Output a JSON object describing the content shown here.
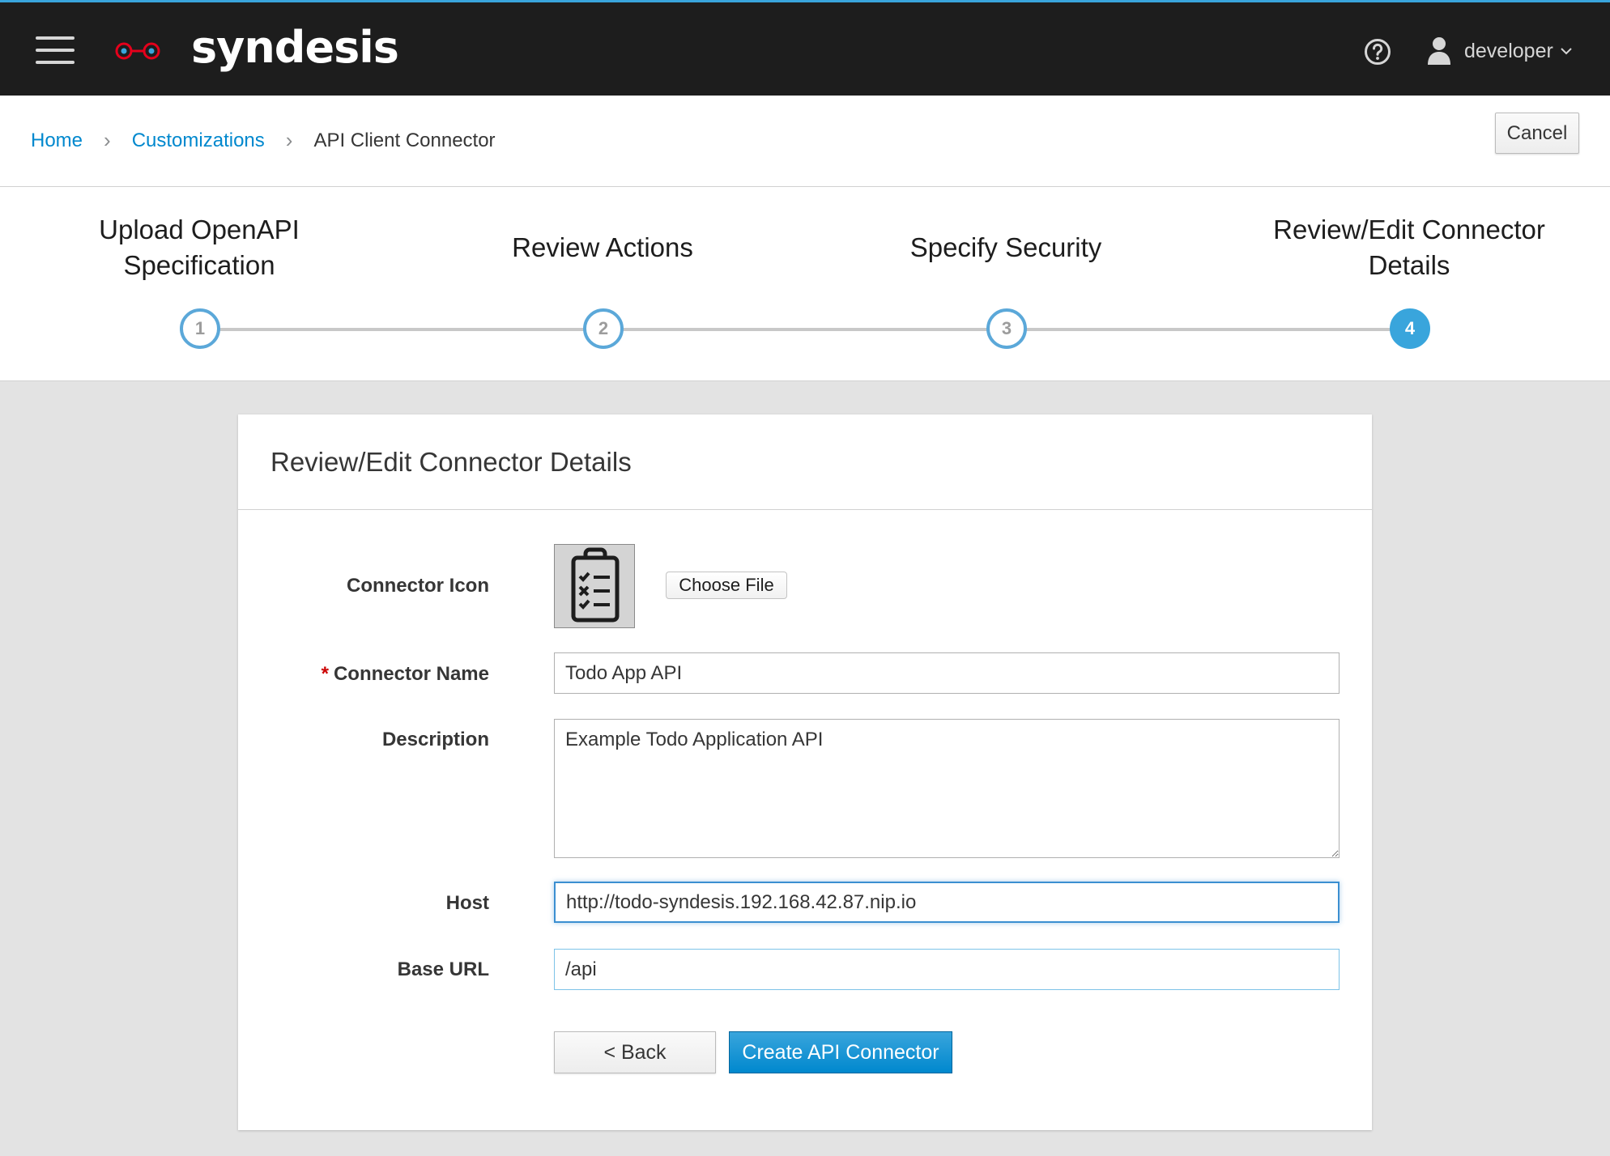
{
  "app": {
    "brand": "syndesis",
    "user": "developer"
  },
  "breadcrumb": {
    "home": "Home",
    "customizations": "Customizations",
    "current": "API Client Connector"
  },
  "toolbar": {
    "cancel_label": "Cancel"
  },
  "wizard": {
    "steps": [
      {
        "label": "Upload OpenAPI Specification",
        "number": "1"
      },
      {
        "label": "Review Actions",
        "number": "2"
      },
      {
        "label": "Specify Security",
        "number": "3"
      },
      {
        "label": "Review/Edit Connector Details",
        "number": "4"
      }
    ],
    "active_step": 4
  },
  "card": {
    "title": "Review/Edit Connector Details"
  },
  "form": {
    "icon_label": "Connector Icon",
    "choose_file_label": "Choose File",
    "name_label": "Connector Name",
    "name_required_marker": "*",
    "name_value": "Todo App API",
    "description_label": "Description",
    "description_value": "Example Todo Application API",
    "host_label": "Host",
    "host_value": "http://todo-syndesis.192.168.42.87.nip.io",
    "base_url_label": "Base URL",
    "base_url_value": "/api",
    "back_label": "< Back",
    "create_label": "Create API Connector"
  },
  "colors": {
    "navbar": "#1d1d1d",
    "accent": "#39a5dc",
    "primary_button": "#0088ce",
    "link": "#0088ce",
    "logo_red": "#e4001b"
  },
  "icons": [
    "hamburger-icon",
    "syndesis-logo-icon",
    "help-icon",
    "user-icon",
    "chevron-down-icon",
    "clipboard-checklist-icon"
  ]
}
